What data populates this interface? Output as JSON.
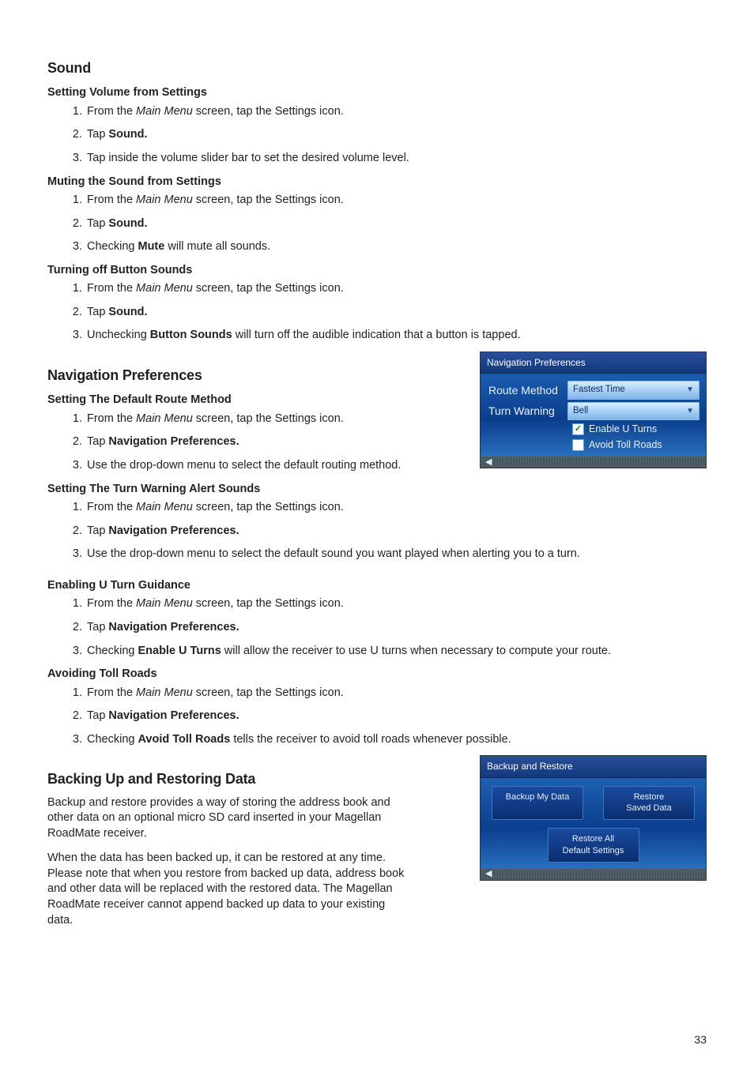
{
  "page_number": "33",
  "sound": {
    "heading": "Sound",
    "s1": {
      "title": "Setting Volume from Settings",
      "step1_pre": "From the ",
      "step1_em": "Main Menu",
      "step1_post": " screen, tap the Settings icon.",
      "step2_pre": "Tap ",
      "step2_b": "Sound.",
      "step3": "Tap inside the volume slider bar to set the desired volume level."
    },
    "s2": {
      "title": "Muting the Sound from Settings",
      "step1_pre": "From the ",
      "step1_em": "Main Menu",
      "step1_post": " screen, tap the Settings icon.",
      "step2_pre": "Tap ",
      "step2_b": "Sound.",
      "step3_pre": "Checking ",
      "step3_b": "Mute",
      "step3_post": " will mute all sounds."
    },
    "s3": {
      "title": "Turning off Button Sounds",
      "step1_pre": "From the ",
      "step1_em": "Main Menu",
      "step1_post": " screen, tap the Settings icon.",
      "step2_pre": "Tap ",
      "step2_b": "Sound.",
      "step3_pre": "Unchecking ",
      "step3_b": "Button Sounds",
      "step3_post": " will turn off the audible indication that a button is tapped."
    }
  },
  "nav": {
    "heading": "Navigation Preferences",
    "fig": {
      "title": "Navigation Preferences",
      "route_label": "Route Method",
      "route_value": "Fastest Time",
      "turn_label": "Turn Warning",
      "turn_value": "Bell",
      "uturn": "Enable U Turns",
      "toll": "Avoid Toll Roads"
    },
    "s1": {
      "title": "Setting The Default Route Method",
      "step1_pre": "From the ",
      "step1_em": "Main Menu",
      "step1_post": " screen, tap the Settings icon.",
      "step2_pre": "Tap ",
      "step2_b": "Navigation Preferences.",
      "step3": "Use the drop-down menu to select the default routing method."
    },
    "s2": {
      "title": "Setting The Turn Warning Alert Sounds",
      "step1_pre": "From the ",
      "step1_em": "Main Menu",
      "step1_post": " screen, tap the Settings icon.",
      "step2_pre": "Tap ",
      "step2_b": "Navigation Preferences.",
      "step3": "Use the drop-down menu to select the default sound you want played when alerting you to a turn."
    },
    "s3": {
      "title": "Enabling U Turn Guidance",
      "step1_pre": "From the ",
      "step1_em": "Main Menu",
      "step1_post": " screen, tap the Settings icon.",
      "step2_pre": "Tap ",
      "step2_b": "Navigation Preferences.",
      "step3_pre": "Checking ",
      "step3_b": "Enable U Turns",
      "step3_post": " will allow the receiver to use U turns when necessary to compute your route."
    },
    "s4": {
      "title": "Avoiding Toll Roads",
      "step1_pre": "From the ",
      "step1_em": "Main Menu",
      "step1_post": " screen, tap the Settings icon.",
      "step2_pre": "Tap ",
      "step2_b": "Navigation Preferences.",
      "step3_pre": "Checking ",
      "step3_b": "Avoid Toll Roads",
      "step3_post": " tells the receiver to avoid toll roads whenever possible."
    }
  },
  "backup": {
    "heading": "Backing Up and Restoring Data",
    "p1": "Backup and restore provides a way of storing the address book and other data on an optional micro SD card inserted in your Magellan RoadMate receiver.",
    "p2": "When the data has been backed up, it can be restored at any time. Please note that when you restore from backed up data, address book and other data will be replaced with the restored data. The Magellan RoadMate receiver cannot append backed up data to your existing data.",
    "fig": {
      "title": "Backup and Restore",
      "btn1": "Backup My Data",
      "btn2a": "Restore",
      "btn2b": "Saved Data",
      "btn3a": "Restore All",
      "btn3b": "Default Settings"
    }
  }
}
